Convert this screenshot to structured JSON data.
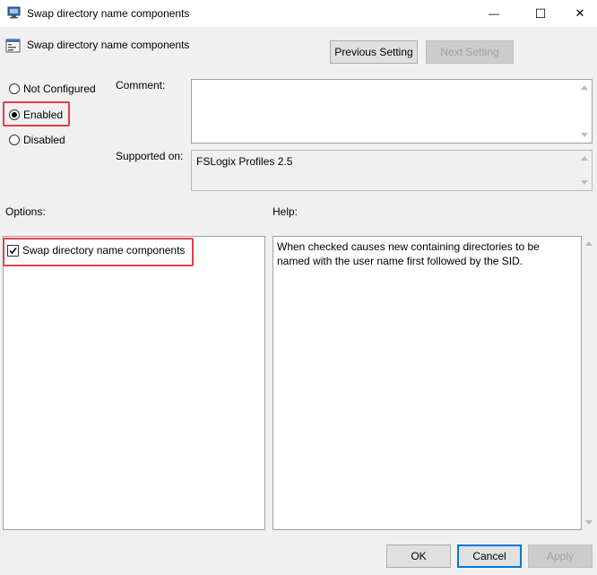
{
  "window": {
    "title": "Swap directory name components",
    "min_glyph": "—",
    "max_glyph": "☐",
    "close_glyph": "✕"
  },
  "header": {
    "title": "Swap directory name components",
    "prev_label": "Previous Setting",
    "next_label": "Next Setting"
  },
  "state": {
    "options": [
      "Not Configured",
      "Enabled",
      "Disabled"
    ],
    "selected": "Enabled"
  },
  "comment": {
    "label": "Comment:",
    "value": ""
  },
  "supported": {
    "label": "Supported on:",
    "value": "FSLogix Profiles 2.5"
  },
  "options_pane": {
    "label": "Options:",
    "checkbox_label": "Swap directory name components",
    "checked": true
  },
  "help_pane": {
    "label": "Help:",
    "text": "When checked causes new containing directories to be named with the user name first followed by the SID."
  },
  "footer": {
    "ok_label": "OK",
    "cancel_label": "Cancel",
    "apply_label": "Apply"
  },
  "colors": {
    "highlight": "#e0404a",
    "accent": "#0078d7"
  }
}
